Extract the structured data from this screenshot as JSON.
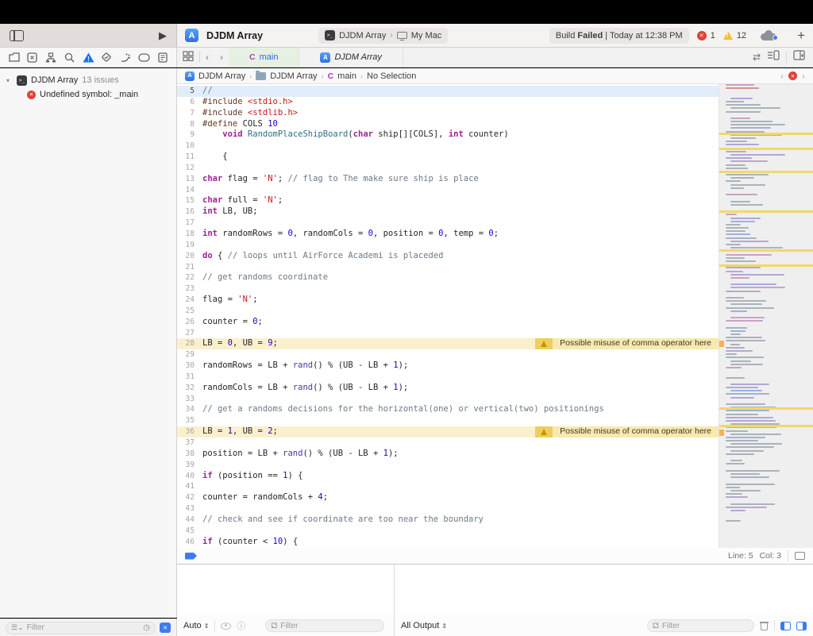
{
  "accent_colors": {
    "blue": "#3E7BF0",
    "error_red": "#E14138",
    "warning_yellow": "#F4BE35",
    "active_tab_green": "#E7F1E3",
    "line_highlight_blue": "#E1EDFA",
    "warning_line_yellow": "#FBF0CE"
  },
  "toolbar": {
    "project_title": "DJDM Array",
    "scheme_name": "DJDM Array",
    "scheme_chevron": "›",
    "destination": "My Mac",
    "status_prefix": "Build ",
    "status_bold": "Failed",
    "status_suffix": " | Today at 12:38 PM",
    "error_count": "1",
    "warning_count": "12",
    "plus_label": "+",
    "play_label": "▶"
  },
  "tabbar": {
    "back": "‹",
    "forward": "›",
    "tabs": [
      {
        "icon": "C",
        "label": "main",
        "active": true
      },
      {
        "icon": "A",
        "label": "DJDM Array",
        "active": false
      }
    ],
    "swap_icon": "⇄"
  },
  "jumpbar": {
    "chevron": "›",
    "segments": {
      "project": "DJDM Array",
      "group": "DJDM Array",
      "file_icon": "C",
      "file": "main",
      "selection": "No Selection"
    },
    "back": "‹",
    "forward": "›"
  },
  "sidebar": {
    "disclosure": "▾",
    "project_row": {
      "terminal_glyph": ">_",
      "name": "DJDM Array",
      "issues": "13 issues"
    },
    "error_row": {
      "glyph": "✕",
      "text": "Undefined symbol: _main"
    },
    "filter_placeholder": "Filter",
    "clock_glyph": "◷",
    "error_filter_glyph": "✕"
  },
  "editor": {
    "annotation_text": "Possible misuse of comma operator here",
    "lines": [
      {
        "n": 5,
        "hl": "blue",
        "t": [
          [
            "c",
            "//"
          ]
        ]
      },
      {
        "n": 6,
        "t": [
          [
            "p",
            "#include "
          ],
          [
            "i",
            "<stdio.h>"
          ]
        ]
      },
      {
        "n": 7,
        "t": [
          [
            "p",
            "#include "
          ],
          [
            "i",
            "<stdlib.h>"
          ]
        ]
      },
      {
        "n": 8,
        "t": [
          [
            "p",
            "#define"
          ],
          [
            "t",
            " COLS "
          ],
          [
            "n",
            "10"
          ]
        ]
      },
      {
        "n": 9,
        "t": [
          [
            "t",
            "    "
          ],
          [
            "k",
            "void"
          ],
          [
            "t",
            " "
          ],
          [
            "f",
            "RandomPlaceShipBoard"
          ],
          [
            "t",
            "("
          ],
          [
            "k",
            "char"
          ],
          [
            "t",
            " ship[][COLS], "
          ],
          [
            "k",
            "int"
          ],
          [
            "t",
            " counter)"
          ]
        ]
      },
      {
        "n": 10,
        "t": []
      },
      {
        "n": 11,
        "t": [
          [
            "t",
            "    {"
          ]
        ]
      },
      {
        "n": 12,
        "t": []
      },
      {
        "n": 13,
        "t": [
          [
            "k",
            "char"
          ],
          [
            "t",
            " flag = "
          ],
          [
            "s",
            "'N'"
          ],
          [
            "t",
            "; "
          ],
          [
            "c",
            "// flag to The make sure ship is place"
          ]
        ]
      },
      {
        "n": 14,
        "t": []
      },
      {
        "n": 15,
        "t": [
          [
            "k",
            "char"
          ],
          [
            "t",
            " full = "
          ],
          [
            "s",
            "'N'"
          ],
          [
            "t",
            ";"
          ]
        ]
      },
      {
        "n": 16,
        "t": [
          [
            "k",
            "int"
          ],
          [
            "t",
            " LB, UB;"
          ]
        ]
      },
      {
        "n": 17,
        "t": []
      },
      {
        "n": 18,
        "t": [
          [
            "k",
            "int"
          ],
          [
            "t",
            " randomRows = "
          ],
          [
            "n",
            "0"
          ],
          [
            "t",
            ", randomCols = "
          ],
          [
            "n",
            "0"
          ],
          [
            "t",
            ", position = "
          ],
          [
            "n",
            "0"
          ],
          [
            "t",
            ", temp = "
          ],
          [
            "n",
            "0"
          ],
          [
            "t",
            ";"
          ]
        ]
      },
      {
        "n": 19,
        "t": []
      },
      {
        "n": 20,
        "t": [
          [
            "k",
            "do"
          ],
          [
            "t",
            " { "
          ],
          [
            "c",
            "// loops until AirForce Academi is placeded"
          ]
        ]
      },
      {
        "n": 21,
        "t": []
      },
      {
        "n": 22,
        "t": [
          [
            "c",
            "// get randoms coordinate"
          ]
        ]
      },
      {
        "n": 23,
        "t": []
      },
      {
        "n": 24,
        "t": [
          [
            "t",
            "flag = "
          ],
          [
            "s",
            "'N'"
          ],
          [
            "t",
            ";"
          ]
        ]
      },
      {
        "n": 25,
        "t": []
      },
      {
        "n": 26,
        "t": [
          [
            "t",
            "counter = "
          ],
          [
            "n",
            "0"
          ],
          [
            "t",
            ";"
          ]
        ]
      },
      {
        "n": 27,
        "t": []
      },
      {
        "n": 28,
        "hl": "yellow",
        "ann": true,
        "t": [
          [
            "t",
            "LB = "
          ],
          [
            "n",
            "0"
          ],
          [
            "t",
            ", UB = "
          ],
          [
            "n",
            "9"
          ],
          [
            "t",
            ";"
          ]
        ]
      },
      {
        "n": 29,
        "t": []
      },
      {
        "n": 30,
        "t": [
          [
            "t",
            "randomRows = LB + "
          ],
          [
            "l",
            "rand"
          ],
          [
            "t",
            "() % (UB - LB + "
          ],
          [
            "n",
            "1"
          ],
          [
            "t",
            ");"
          ]
        ]
      },
      {
        "n": 31,
        "t": []
      },
      {
        "n": 32,
        "t": [
          [
            "t",
            "randomCols = LB + "
          ],
          [
            "l",
            "rand"
          ],
          [
            "t",
            "() % (UB - LB + "
          ],
          [
            "n",
            "1"
          ],
          [
            "t",
            ");"
          ]
        ]
      },
      {
        "n": 33,
        "t": []
      },
      {
        "n": 34,
        "t": [
          [
            "c",
            "// get a randoms decisions for the horizontal(one) or vertical(two) positionings"
          ]
        ]
      },
      {
        "n": 35,
        "t": []
      },
      {
        "n": 36,
        "hl": "yellow",
        "ann": true,
        "t": [
          [
            "t",
            "LB = "
          ],
          [
            "n",
            "1"
          ],
          [
            "t",
            ", UB = "
          ],
          [
            "n",
            "2"
          ],
          [
            "t",
            ";"
          ]
        ]
      },
      {
        "n": 37,
        "t": []
      },
      {
        "n": 38,
        "t": [
          [
            "t",
            "position = LB + "
          ],
          [
            "l",
            "rand"
          ],
          [
            "t",
            "() % (UB - LB + "
          ],
          [
            "n",
            "1"
          ],
          [
            "t",
            ");"
          ]
        ]
      },
      {
        "n": 39,
        "t": []
      },
      {
        "n": 40,
        "t": [
          [
            "k",
            "if"
          ],
          [
            "t",
            " (position == "
          ],
          [
            "n",
            "1"
          ],
          [
            "t",
            ") {"
          ]
        ]
      },
      {
        "n": 41,
        "t": []
      },
      {
        "n": 42,
        "t": [
          [
            "t",
            "counter = randomCols + "
          ],
          [
            "n",
            "4"
          ],
          [
            "t",
            ";"
          ]
        ]
      },
      {
        "n": 43,
        "t": []
      },
      {
        "n": 44,
        "t": [
          [
            "c",
            "// check and see if coordinate are too near the boundary"
          ]
        ]
      },
      {
        "n": 45,
        "t": []
      },
      {
        "n": 46,
        "t": [
          [
            "k",
            "if"
          ],
          [
            "t",
            " (counter < "
          ],
          [
            "n",
            "10"
          ],
          [
            "t",
            ") {"
          ]
        ]
      }
    ],
    "statusbar": {
      "line": "Line: 5",
      "col": "Col: 3"
    }
  },
  "minimap": {
    "seed": 13,
    "rows": 132,
    "bar_colors": [
      "#AAB3BB",
      "#AAB3BB",
      "#AAB3BB",
      "#AAB3BB",
      "#B4A6D6",
      "#9FB0E0",
      "#C9A3C6"
    ],
    "override_colors": {
      "1": "#D9928B",
      "2": "#D9928B"
    },
    "warn_positions": [
      0.106,
      0.139,
      0.189,
      0.276,
      0.36,
      0.393,
      0.705,
      0.743
    ],
    "fixit_positions": [
      0.56,
      0.754
    ]
  },
  "debug": {
    "variables_bar": {
      "auto_label": "Auto",
      "stepper": "⇕",
      "filter_placeholder": "Filter"
    },
    "console_bar": {
      "output_label": "All Output",
      "stepper": "⇕",
      "filter_placeholder": "Filter"
    }
  }
}
